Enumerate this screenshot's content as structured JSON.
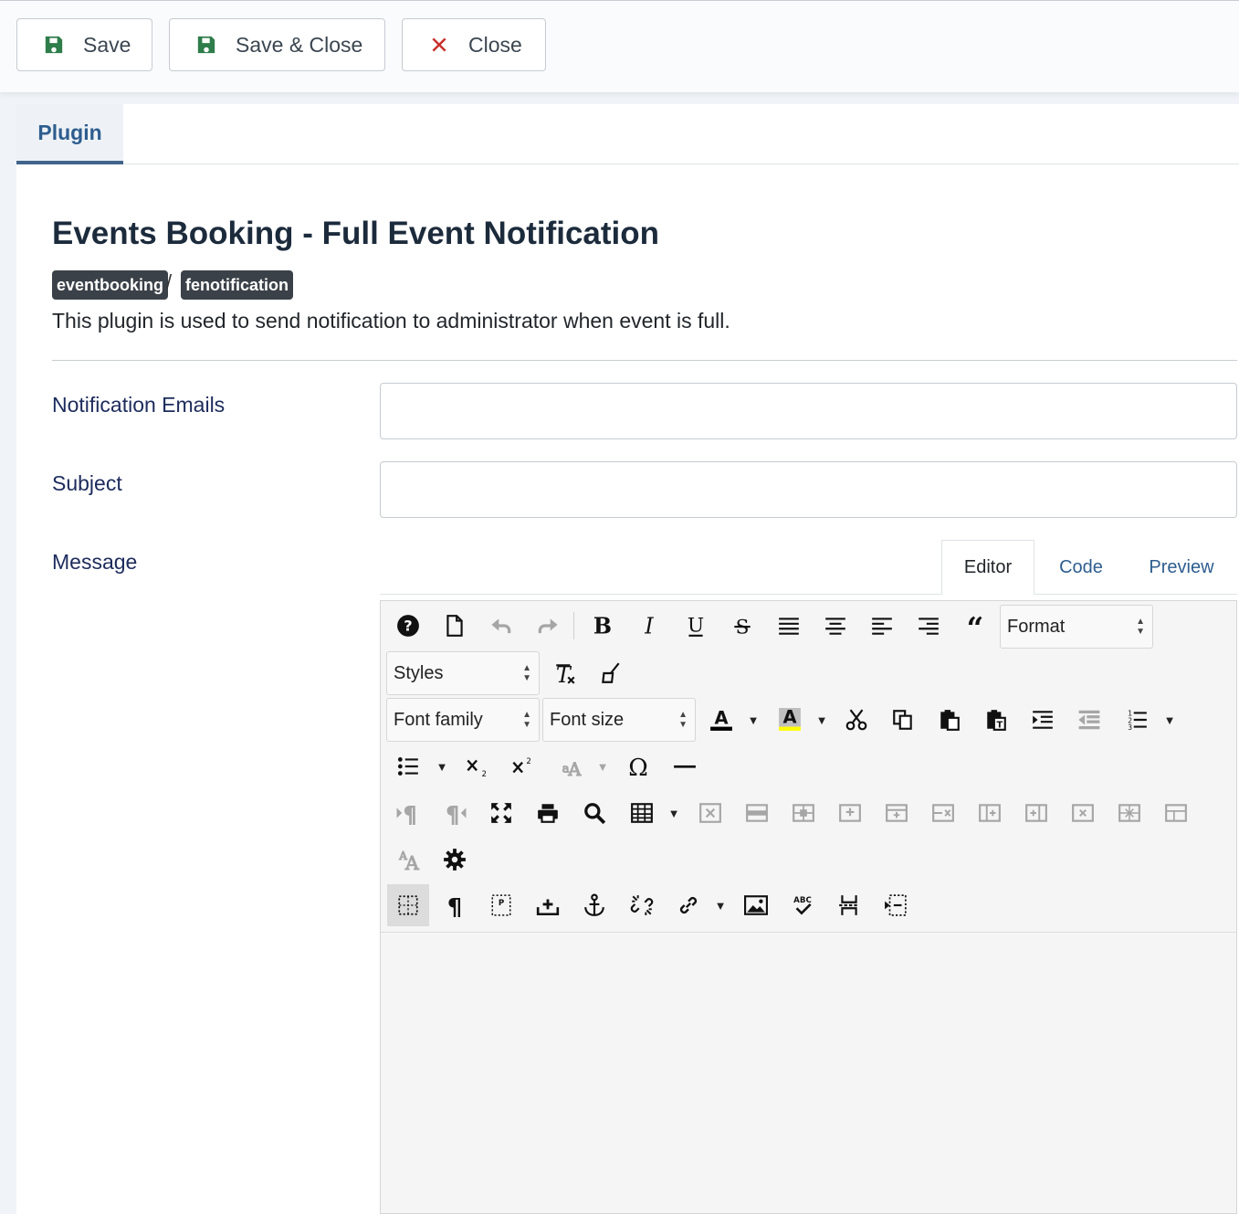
{
  "toolbar": {
    "save": "Save",
    "save_close": "Save & Close",
    "close": "Close"
  },
  "tabs": {
    "plugin": "Plugin"
  },
  "plugin": {
    "title": "Events Booking - Full Event Notification",
    "badges": [
      "eventbooking",
      "fenotification"
    ],
    "separator": "/",
    "description": "This plugin is used to send notification to administrator when event is full."
  },
  "form": {
    "notification_emails_label": "Notification Emails",
    "notification_emails_value": "",
    "subject_label": "Subject",
    "subject_value": "",
    "message_label": "Message"
  },
  "editor": {
    "tabs": [
      "Editor",
      "Code",
      "Preview"
    ],
    "format_select": "Format",
    "styles_select": "Styles",
    "font_family_select": "Font family",
    "font_size_select": "Font size",
    "colors": {
      "text_color": "#000000",
      "highlight_color": "#ffff00"
    }
  },
  "colors": {
    "accent": "#2d5d8f",
    "save_icon": "#2f7d4a",
    "close_icon": "#c9302c",
    "badge_bg": "#3b4148"
  }
}
